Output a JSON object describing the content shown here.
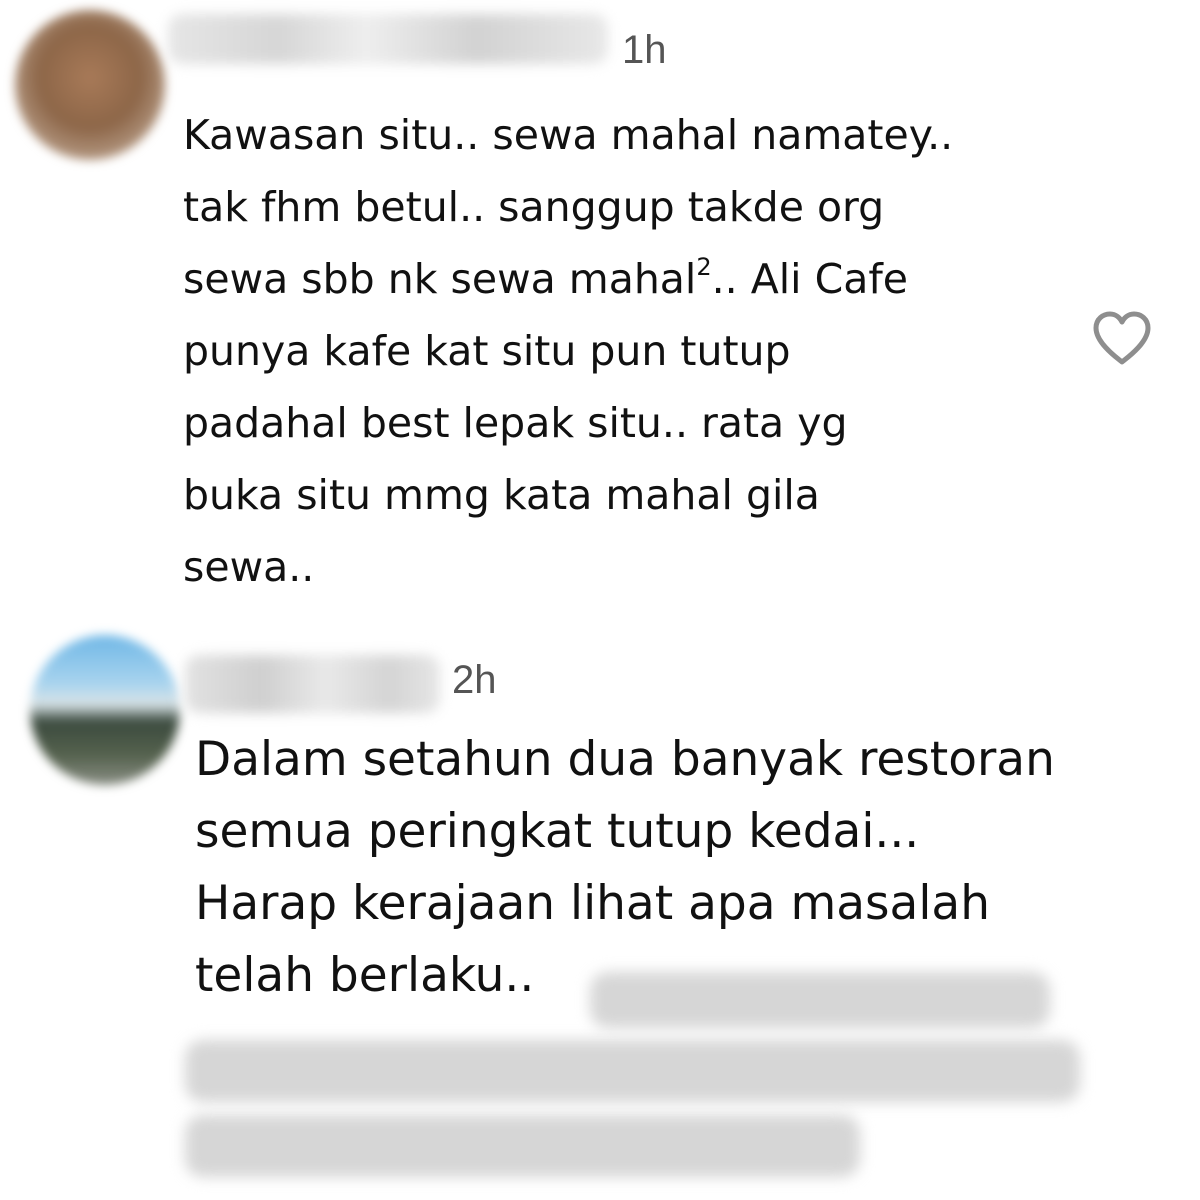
{
  "comments": [
    {
      "timestamp": "1h",
      "lines": [
        "Kawasan situ.. sewa mahal namatey..",
        "tak fhm betul.. sanggup takde org",
        "sewa sbb nk sewa mahal",
        "punya kafe kat situ pun tutup",
        "padahal best lepak situ.. rata yg",
        "buka situ mmg kata mahal gila",
        "sewa.."
      ],
      "superscript": "2",
      "line3_tail": ".. Ali Cafe",
      "like_icon": "heart-outline-icon"
    },
    {
      "timestamp": "2h",
      "lines": [
        "Dalam setahun dua banyak restoran",
        "semua peringkat tutup kedai...",
        "Harap kerajaan lihat apa masalah",
        "telah berlaku.."
      ]
    }
  ],
  "colors": {
    "background": "#ffffff",
    "text": "#111111",
    "timestamp": "#555555",
    "icon": "#8e8e8e"
  }
}
